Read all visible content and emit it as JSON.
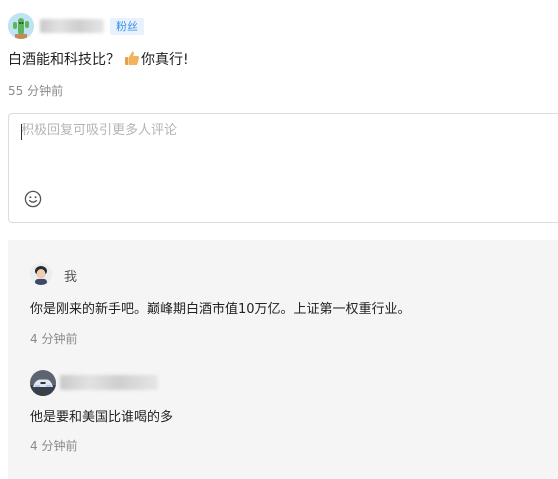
{
  "main_comment": {
    "badge": "粉丝",
    "text_before_emoji": "白酒能和科技比？",
    "emoji": "thumbs-up",
    "text_after_emoji": "你真行!",
    "time": "55 分钟前"
  },
  "reply_box": {
    "placeholder": "积极回复可吸引更多人评论",
    "emoji_icon": "smiley-icon"
  },
  "replies": [
    {
      "user": "我",
      "text": "你是刚来的新手吧。巅峰期白酒市值10万亿。上证第一权重行业。",
      "time": "4 分钟前"
    },
    {
      "user": "",
      "text": "他是要和美国比谁喝的多",
      "time": "4 分钟前"
    }
  ],
  "colors": {
    "badge_text": "#3d8fe6",
    "badge_bg": "#e8f2fd",
    "thread_bg": "#f5f5f5",
    "muted_text": "#8a8a8a"
  }
}
